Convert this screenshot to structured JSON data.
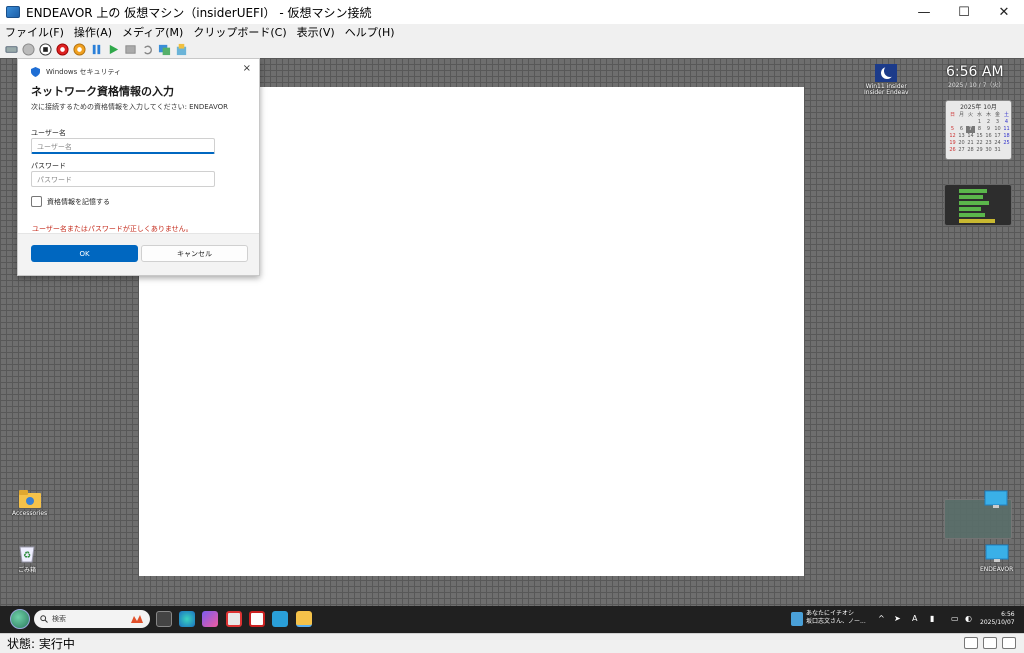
{
  "window": {
    "title": "ENDEAVOR 上の 仮想マシン（insiderUEFI） - 仮想マシン接続",
    "minimize": "—",
    "maximize": "☐",
    "close": "✕"
  },
  "menu": [
    "ファイル(F)",
    "操作(A)",
    "メディア(M)",
    "クリップボード(C)",
    "表示(V)",
    "ヘルプ(H)"
  ],
  "toolbar": {
    "icons": [
      "ctrl-alt-del-icon",
      "start-icon",
      "turn-off-icon",
      "shutdown-icon",
      "save-icon",
      "pause-icon",
      "resume-icon",
      "checkpoint-icon",
      "revert-icon",
      "enhanced-session-icon",
      "share-icon"
    ]
  },
  "dialog": {
    "header": "Windows セキュリティ",
    "close": "×",
    "title": "ネットワーク資格情報の入力",
    "subtitle": "次に接続するための資格情報を入力してください: ENDEAVOR",
    "username_label": "ユーザー名",
    "username_placeholder": "ユーザー名",
    "password_label": "パスワード",
    "password_placeholder": "パスワード",
    "remember_label": "資格情報を記憶する",
    "error": "ユーザー名またはパスワードが正しくありません。",
    "ok": "OK",
    "cancel": "キャンセル"
  },
  "desktop": {
    "clock": "6:56 AM",
    "clock_date": "2025 / 10 / 7（火）",
    "calendar_title": "2025年 10月",
    "calendar_days": [
      "日",
      "月",
      "火",
      "水",
      "木",
      "金",
      "土",
      "",
      "",
      "",
      "1",
      "2",
      "3",
      "4",
      "5",
      "6",
      "7",
      "8",
      "9",
      "10",
      "11",
      "12",
      "13",
      "14",
      "15",
      "16",
      "17",
      "18",
      "19",
      "20",
      "21",
      "22",
      "23",
      "24",
      "25",
      "26",
      "27",
      "28",
      "29",
      "30",
      "31",
      ""
    ],
    "top_icon_label": "Win11 insider\nInsider Endeav",
    "icons": [
      {
        "label": "Accessories"
      },
      {
        "label": "ごみ箱"
      },
      {
        "label": "ENDEAVOR"
      }
    ]
  },
  "taskbar": {
    "search_placeholder": "検索",
    "news_line1": "あなたにイチオシ",
    "news_line2": "坂口志文さん、ノー...",
    "time": "6:56",
    "date": "2025/10/07"
  },
  "statusbar": {
    "status": "状態: 実行中"
  }
}
